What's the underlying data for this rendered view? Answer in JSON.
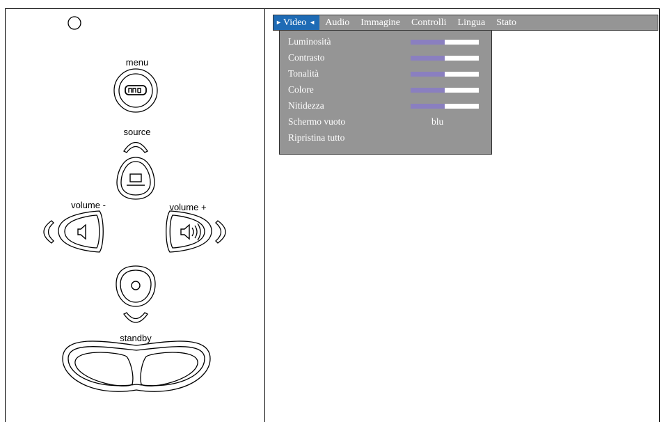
{
  "remote": {
    "menu_label": "menu",
    "source_label": "source",
    "volume_minus_label": "volume -",
    "volume_plus_label": "volume +",
    "standby_label": "standby"
  },
  "osd": {
    "tabs": [
      {
        "label": "Video",
        "active": true
      },
      {
        "label": "Audio"
      },
      {
        "label": "Immagine"
      },
      {
        "label": "Controlli"
      },
      {
        "label": "Lingua"
      },
      {
        "label": "Stato"
      }
    ],
    "items": [
      {
        "label": "Luminosità",
        "level": 0.5
      },
      {
        "label": "Contrasto",
        "level": 0.5
      },
      {
        "label": "Tonalità",
        "level": 0.5
      },
      {
        "label": "Colore",
        "level": 0.5
      },
      {
        "label": "Nitidezza",
        "level": 0.5
      },
      {
        "label": "Schermo vuoto",
        "value": "blu"
      },
      {
        "label": "Ripristina tutto"
      }
    ],
    "colors": {
      "menu_bg": "#959595",
      "active_tab": "#1e6bb5",
      "bar_fill": "#8a7fc0"
    }
  }
}
